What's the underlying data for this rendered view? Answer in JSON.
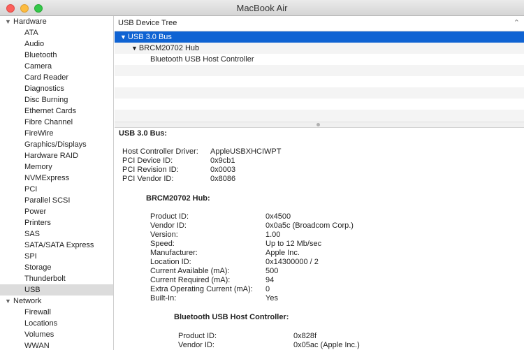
{
  "window": {
    "title": "MacBook Air"
  },
  "sidebar": {
    "categories": [
      {
        "label": "Hardware",
        "items": [
          "ATA",
          "Audio",
          "Bluetooth",
          "Camera",
          "Card Reader",
          "Diagnostics",
          "Disc Burning",
          "Ethernet Cards",
          "Fibre Channel",
          "FireWire",
          "Graphics/Displays",
          "Hardware RAID",
          "Memory",
          "NVMExpress",
          "PCI",
          "Parallel SCSI",
          "Power",
          "Printers",
          "SAS",
          "SATA/SATA Express",
          "SPI",
          "Storage",
          "Thunderbolt",
          "USB"
        ]
      },
      {
        "label": "Network",
        "items": [
          "Firewall",
          "Locations",
          "Volumes",
          "WWAN"
        ]
      }
    ],
    "selected": "USB"
  },
  "tree": {
    "header": "USB Device Tree",
    "rows": [
      {
        "label": "USB 3.0 Bus",
        "level": 0,
        "expanded": true,
        "selected": true
      },
      {
        "label": "BRCM20702 Hub",
        "level": 1,
        "expanded": true,
        "selected": false
      },
      {
        "label": "Bluetooth USB Host Controller",
        "level": 2,
        "expanded": false,
        "selected": false
      }
    ]
  },
  "detail": {
    "bus": {
      "title": "USB 3.0 Bus:",
      "fields": [
        [
          "Host Controller Driver:",
          "AppleUSBXHCIWPT"
        ],
        [
          "PCI Device ID:",
          "0x9cb1"
        ],
        [
          "PCI Revision ID:",
          "0x0003"
        ],
        [
          "PCI Vendor ID:",
          "0x8086"
        ]
      ]
    },
    "hub": {
      "title": "BRCM20702 Hub:",
      "fields": [
        [
          "Product ID:",
          "0x4500"
        ],
        [
          "Vendor ID:",
          "0x0a5c  (Broadcom Corp.)"
        ],
        [
          "Version:",
          "1.00"
        ],
        [
          "Speed:",
          "Up to 12 Mb/sec"
        ],
        [
          "Manufacturer:",
          "Apple Inc."
        ],
        [
          "Location ID:",
          "0x14300000 / 2"
        ],
        [
          "Current Available (mA):",
          "500"
        ],
        [
          "Current Required (mA):",
          "94"
        ],
        [
          "Extra Operating Current (mA):",
          "0"
        ],
        [
          "Built-In:",
          "Yes"
        ]
      ]
    },
    "controller": {
      "title": "Bluetooth USB Host Controller:",
      "fields": [
        [
          "Product ID:",
          "0x828f"
        ],
        [
          "Vendor ID:",
          "0x05ac  (Apple Inc.)"
        ]
      ]
    }
  }
}
